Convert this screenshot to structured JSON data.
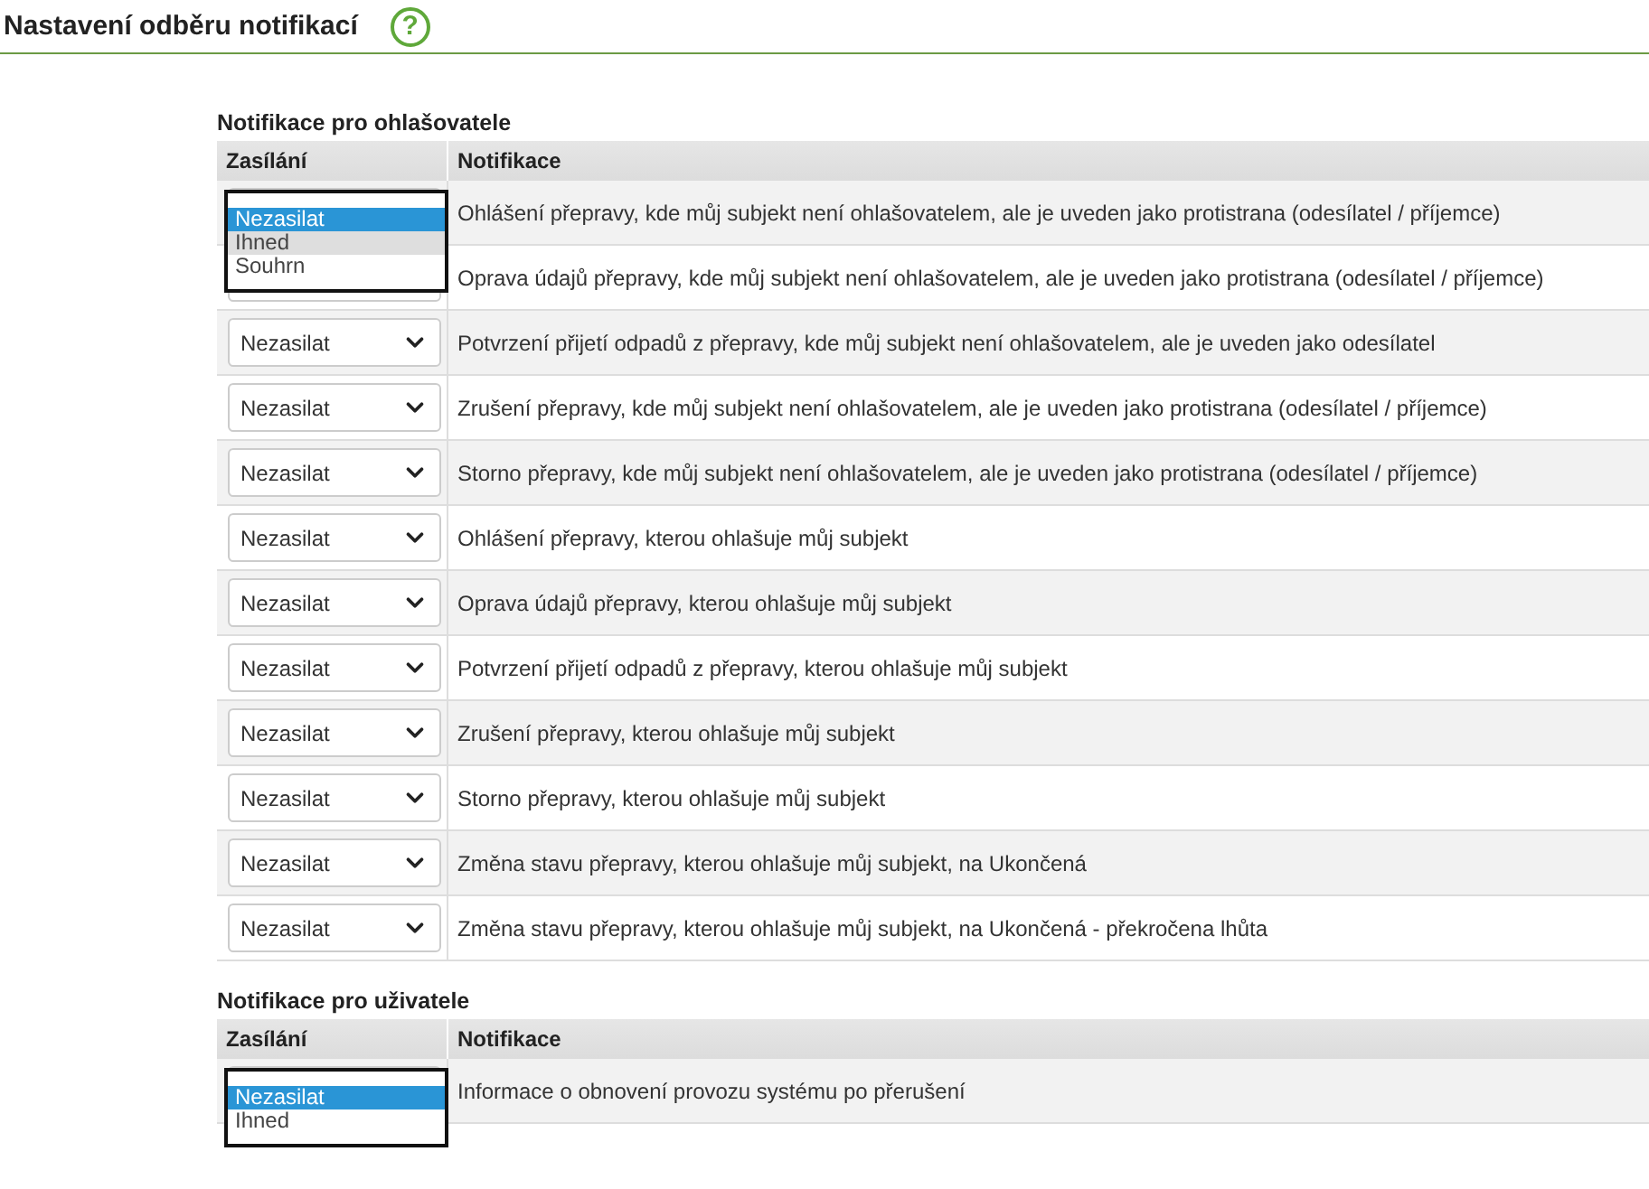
{
  "title": "Nastavení odběru notifikací",
  "help": {
    "label": "?"
  },
  "sections": [
    {
      "heading": "Notifikace pro ohlašovatele",
      "columns": [
        "Zasílání",
        "Notifikace"
      ],
      "rows": [
        {
          "select": {
            "open": true,
            "options": [
              {
                "label": "Nezasilat",
                "selected": true,
                "hovered": false
              },
              {
                "label": "Ihned",
                "selected": false,
                "hovered": true
              },
              {
                "label": "Souhrn",
                "selected": false,
                "hovered": false
              }
            ]
          },
          "text": "Ohlášení přepravy, kde můj subjekt není ohlašovatelem, ale je uveden jako protistrana (odesílatel / příjemce)"
        },
        {
          "text": "Oprava údajů přepravy, kde můj subjekt není ohlašovatelem, ale je uveden jako protistrana (odesílatel / příjemce)"
        },
        {
          "select": {
            "value": "Nezasilat",
            "open": false
          },
          "text": "Potvrzení přijetí odpadů z přepravy, kde můj subjekt není ohlašovatelem, ale je uveden jako odesílatel"
        },
        {
          "select": {
            "value": "Nezasilat",
            "open": false
          },
          "text": "Zrušení přepravy, kde můj subjekt není ohlašovatelem, ale je uveden jako protistrana (odesílatel / příjemce)"
        },
        {
          "select": {
            "value": "Nezasilat",
            "open": false
          },
          "text": "Storno přepravy, kde můj subjekt není ohlašovatelem, ale je uveden jako protistrana (odesílatel / příjemce)"
        },
        {
          "select": {
            "value": "Nezasilat",
            "open": false
          },
          "text": "Ohlášení přepravy, kterou ohlašuje můj subjekt"
        },
        {
          "select": {
            "value": "Nezasilat",
            "open": false
          },
          "text": "Oprava údajů přepravy, kterou ohlašuje můj subjekt"
        },
        {
          "select": {
            "value": "Nezasilat",
            "open": false
          },
          "text": "Potvrzení přijetí odpadů z přepravy, kterou ohlašuje můj subjekt"
        },
        {
          "select": {
            "value": "Nezasilat",
            "open": false
          },
          "text": "Zrušení přepravy, kterou ohlašuje můj subjekt"
        },
        {
          "select": {
            "value": "Nezasilat",
            "open": false
          },
          "text": "Storno přepravy, kterou ohlašuje můj subjekt"
        },
        {
          "select": {
            "value": "Nezasilat",
            "open": false
          },
          "text": "Změna stavu přepravy, kterou ohlašuje můj subjekt, na Ukončená"
        },
        {
          "select": {
            "value": "Nezasilat",
            "open": false
          },
          "text": "Změna stavu přepravy, kterou ohlašuje můj subjekt, na Ukončená - překročena lhůta"
        }
      ]
    },
    {
      "heading": "Notifikace pro uživatele",
      "columns": [
        "Zasílání",
        "Notifikace"
      ],
      "rows": [
        {
          "select": {
            "open": true,
            "options": [
              {
                "label": "Nezasilat",
                "selected": true,
                "hovered": false
              },
              {
                "label": "Ihned",
                "selected": false,
                "hovered": false
              }
            ]
          },
          "text": "Informace o obnovení provozu systému po přerušení"
        }
      ]
    }
  ]
}
